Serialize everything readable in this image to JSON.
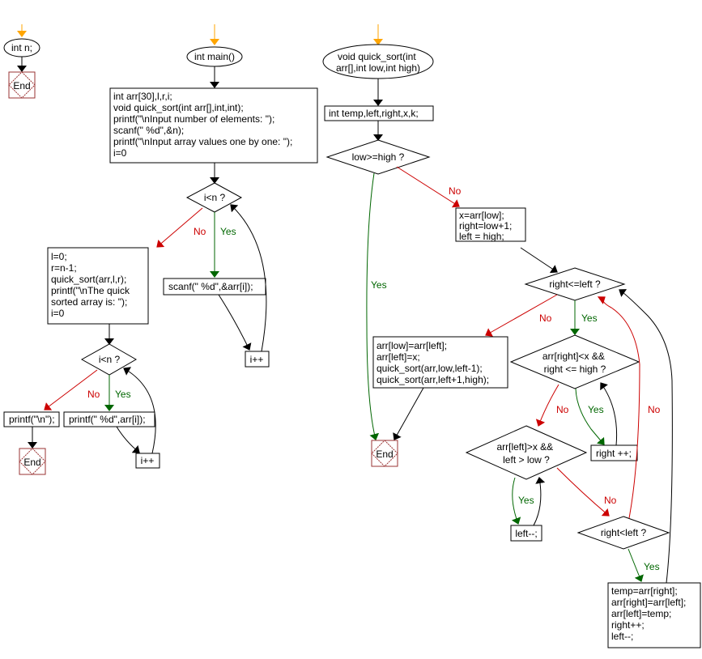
{
  "colors": {
    "start_arrow": "#ffa500",
    "edge": "#000000",
    "no_edge": "#cc0000",
    "yes_edge": "#006600",
    "end_node": "#993333"
  },
  "labels": {
    "yes": "Yes",
    "no": "No"
  },
  "global_flow": {
    "decl": "int n;",
    "end": "End"
  },
  "main_flow": {
    "start": "int main()",
    "init_lines": [
      "int arr[30],l,r,i;",
      "void quick_sort(int arr[],int,int);",
      "printf(\"\\nInput number of elements:  \");",
      "scanf(\" %d\",&n);",
      "printf(\"\\nInput  array values one by one: \");",
      "i=0"
    ],
    "loop1_cond": "i<n ?",
    "loop1_body": "scanf(\" %d\",&arr[i]);",
    "loop1_inc": "i++",
    "after_loop1_lines": [
      "l=0;",
      "r=n-1;",
      "quick_sort(arr,l,r);",
      "printf(\"\\nThe quick",
      "sorted array is:  \");",
      "i=0"
    ],
    "loop2_cond": "i<n ?",
    "loop2_body": "printf(\" %d\",arr[i]);",
    "loop2_inc": "i++",
    "after_loop2": "printf(\"\\n\");",
    "end": "End"
  },
  "quick_sort_flow": {
    "start_lines": [
      "void quick_sort(int",
      "arr[],int low,int high)"
    ],
    "decl": "int temp,left,right,x,k;",
    "cond_base": "low>=high ?",
    "init_lines": [
      "x=arr[low];",
      "right=low+1;",
      "left = high;"
    ],
    "cond_outer": "right<=left ?",
    "final_lines": [
      "arr[low]=arr[left];",
      "arr[left]=x;",
      "quick_sort(arr,low,left-1);",
      "quick_sort(arr,left+1,high);"
    ],
    "end": "End",
    "cond_right_lines": [
      "arr[right]<x &&",
      "right <= high ?"
    ],
    "right_inc": "right ++;",
    "cond_left_lines": [
      "arr[left]>x &&",
      "left > low ?"
    ],
    "left_dec": "left--;",
    "cond_swap": "right<left ?",
    "swap_lines": [
      "temp=arr[right];",
      "arr[right]=arr[left];",
      "arr[left]=temp;",
      "right++;",
      "left--;"
    ]
  }
}
